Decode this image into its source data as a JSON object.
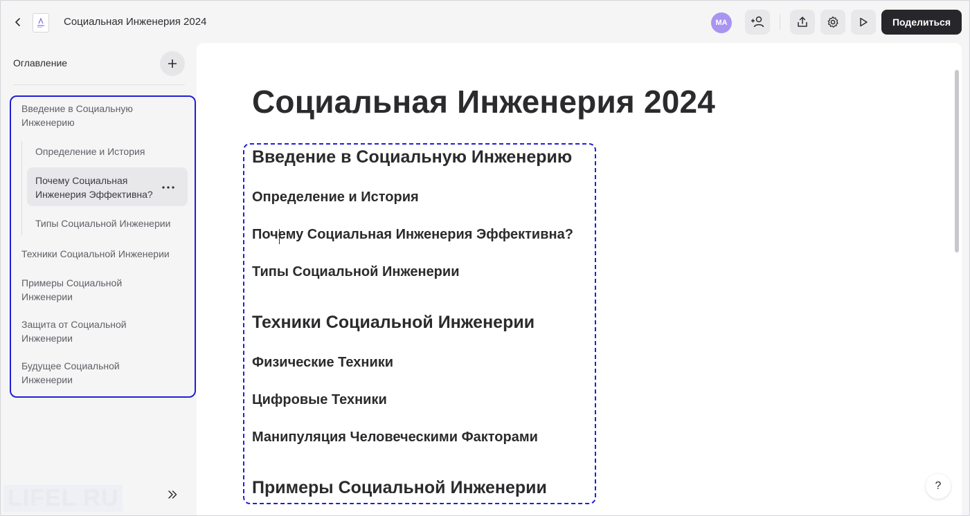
{
  "topbar": {
    "title": "Социальная Инженерия 2024",
    "avatar_initials": "MA",
    "share_label": "Поделиться",
    "icons": [
      "chevron-left-icon",
      "document-icon",
      "add-user-icon",
      "upload-icon",
      "gear-icon",
      "play-icon"
    ]
  },
  "sidebar": {
    "header": "Оглавление",
    "items": [
      {
        "label": "Введение в Социальную Инженерию",
        "level": 1
      },
      {
        "label": "Определение и История",
        "level": 2
      },
      {
        "label": "Почему Социальная Инженерия Эффективна?",
        "level": 2,
        "active": true
      },
      {
        "label": "Типы Социальной Инженерии",
        "level": 2
      },
      {
        "label": "Техники Социальной Инженерии",
        "level": 1
      },
      {
        "label": "Примеры Социальной Инженерии",
        "level": 1
      },
      {
        "label": "Защита от Социальной Инженерии",
        "level": 1
      },
      {
        "label": "Будущее Социальной Инженерии",
        "level": 1
      }
    ],
    "watermark": "LIFEL RU"
  },
  "document": {
    "title": "Социальная Инженерия 2024",
    "outline": [
      {
        "text": "Введение в Социальную Инженерию",
        "level": "h2"
      },
      {
        "text": "Определение и История",
        "level": "h3"
      },
      {
        "text": "Почему Социальная Инженерия Эффективна?",
        "level": "h3"
      },
      {
        "text": "Типы Социальной Инженерии",
        "level": "h3"
      },
      {
        "text": "Техники Социальной Инженерии",
        "level": "h2"
      },
      {
        "text": "Физические Техники",
        "level": "h3"
      },
      {
        "text": "Цифровые Техники",
        "level": "h3"
      },
      {
        "text": "Манипуляция Человеческими Факторами",
        "level": "h3"
      },
      {
        "text": "Примеры Социальной Инженерии",
        "level": "h2"
      }
    ]
  },
  "help": {
    "label": "?"
  },
  "colors": {
    "accent": "#1f1fd6",
    "avatar": "#a995f0",
    "share_bg": "#27272b"
  }
}
